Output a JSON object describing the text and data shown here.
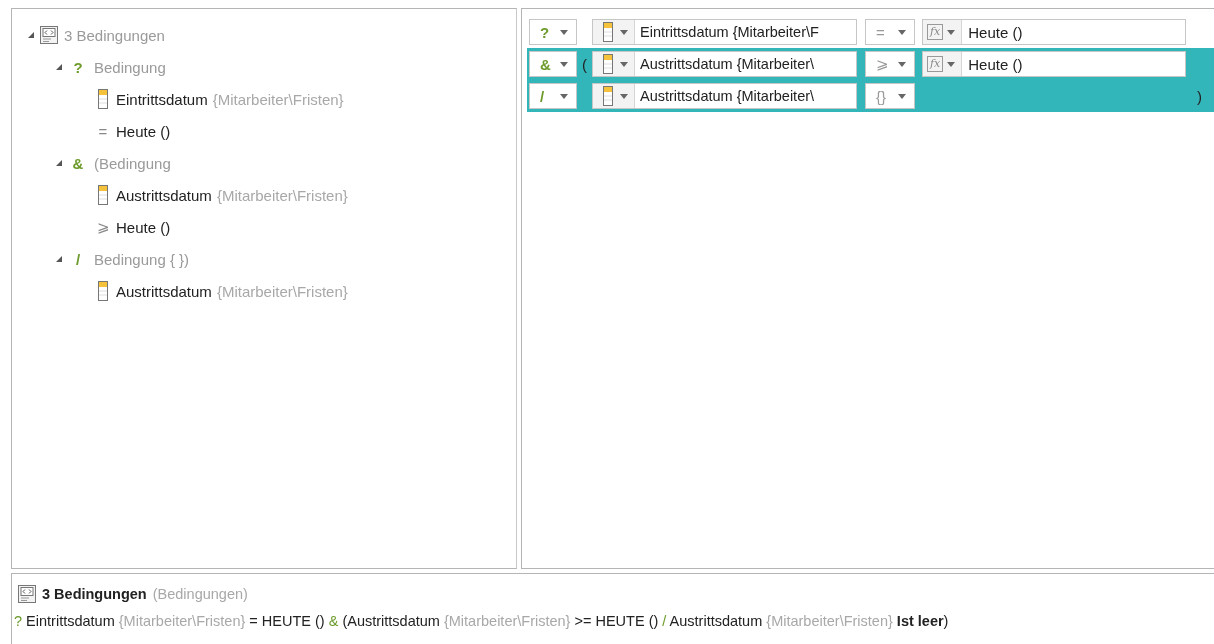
{
  "tree": {
    "root": {
      "label": "3 Bedingungen",
      "expanded": true,
      "children": [
        {
          "connector": "?",
          "label": "Bedingung",
          "expanded": true,
          "children": [
            {
              "kind": "field",
              "name": "Eintrittsdatum",
              "path": "{Mitarbeiter\\Fristen}"
            },
            {
              "kind": "operator",
              "symbol": "=",
              "value": "Heute ()"
            }
          ]
        },
        {
          "connector": "&",
          "label": "(Bedingung",
          "expanded": true,
          "children": [
            {
              "kind": "field",
              "name": "Austrittsdatum",
              "path": "{Mitarbeiter\\Fristen}"
            },
            {
              "kind": "operator",
              "symbol": "⩾",
              "value": "Heute ()"
            }
          ]
        },
        {
          "connector": "/",
          "label": "Bedingung { })",
          "expanded": true,
          "children": [
            {
              "kind": "field",
              "name": "Austrittsdatum",
              "path": "{Mitarbeiter\\Fristen}"
            }
          ]
        }
      ]
    }
  },
  "editor": {
    "rows": [
      {
        "selected": false,
        "connector": "?",
        "field": "Eintrittsdatum {Mitarbeiter\\F",
        "operator": "=",
        "function_icon": "fx",
        "value": "Heute ()"
      },
      {
        "selected": true,
        "connector": "&",
        "open_paren": "(",
        "field": "Austrittsdatum {Mitarbeiter\\",
        "operator": "⩾",
        "function_icon": "fx",
        "value": "Heute ()"
      },
      {
        "selected": true,
        "connector": "/",
        "field": "Austrittsdatum {Mitarbeiter\\",
        "operator": "{}",
        "close_paren": ")"
      }
    ]
  },
  "summary": {
    "title": "3 Bedingungen",
    "subtitle": "(Bedingungen)",
    "formula": [
      {
        "kind": "op",
        "text": "?"
      },
      {
        "kind": "text",
        "text": " Eintrittsdatum "
      },
      {
        "kind": "path",
        "text": "{Mitarbeiter\\Fristen}"
      },
      {
        "kind": "text",
        "text": " = HEUTE () "
      },
      {
        "kind": "op",
        "text": "&"
      },
      {
        "kind": "text",
        "text": " (Austrittsdatum "
      },
      {
        "kind": "path",
        "text": "{Mitarbeiter\\Fristen}"
      },
      {
        "kind": "text",
        "text": " >= HEUTE () "
      },
      {
        "kind": "op",
        "text": "/"
      },
      {
        "kind": "text",
        "text": " Austrittsdatum "
      },
      {
        "kind": "path",
        "text": "{Mitarbeiter\\Fristen}"
      },
      {
        "kind": "bold",
        "text": " Ist leer"
      },
      {
        "kind": "text",
        "text": ")"
      }
    ]
  }
}
